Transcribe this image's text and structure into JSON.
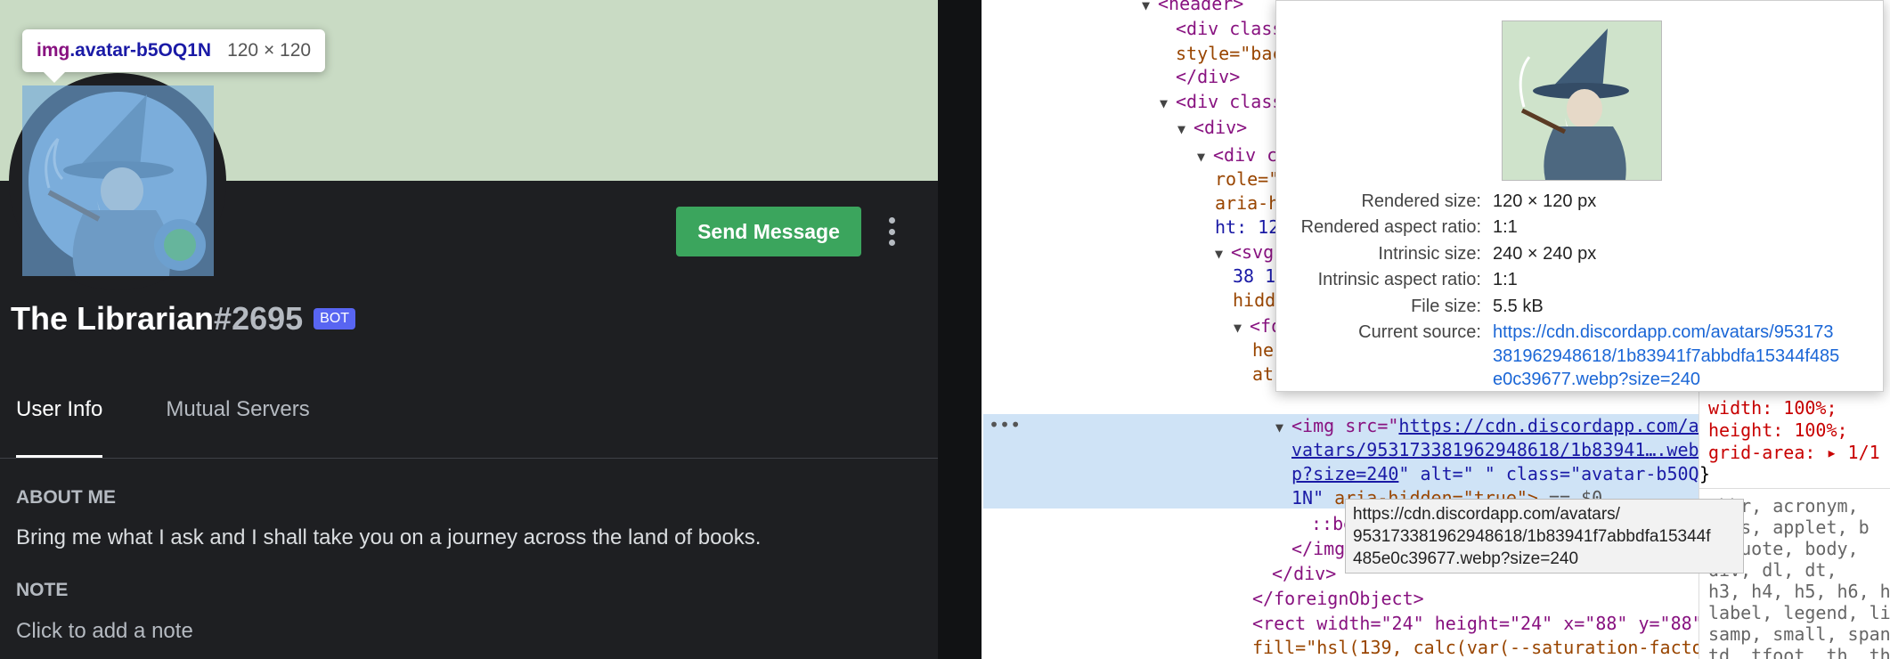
{
  "inspect_tooltip": {
    "tag": "img",
    "class_name": ".avatar-b5OQ1N",
    "size": "120 × 120"
  },
  "profile": {
    "send_message_label": "Send Message",
    "username": "The Librarian",
    "discriminator": "#2695",
    "bot_tag": "BOT",
    "tabs": [
      {
        "label": "User Info",
        "active": true
      },
      {
        "label": "Mutual Servers",
        "active": false
      }
    ],
    "about_heading": "ABOUT ME",
    "about_text": "Bring me what I ask and I shall take you on a journey across the land of books.",
    "note_heading": "NOTE",
    "note_placeholder": "Click to add a note",
    "colors": {
      "banner": "#c9dbc4",
      "button": "#3ba55d",
      "bot_tag": "#5865f2",
      "status": "#66b59c"
    }
  },
  "devtools": {
    "lines": {
      "header": "<header>",
      "div_class_1": "<div class",
      "style_ba": "style=\"bac",
      "div_close": "</div>",
      "div_class_2": "<div class",
      "div_open": "<div>",
      "div_c": "<div c",
      "role": "role=\"",
      "aria_h": "aria-h",
      "ht_12": "ht: 12",
      "svg": "<svg",
      "n38_1": "38 1",
      "hidd": "hidd",
      "fo": "<fo",
      "he": "he",
      "at": "at",
      "img_line_1_open": "<img src=\"",
      "img_url_1": "https://cdn.discordapp.com/a",
      "img_url_2": "vatars/953173381962948618/1b83941….web",
      "img_url_3": "p?size=240",
      "img_alt_class": "\" alt=\" \" class=\"avatar-b50Q",
      "img_class_end": "1N\"",
      "img_aria": " aria-hidden=\"true\"> ",
      "img_eq": "== $0",
      "before": "::be",
      "img_close": "</img>",
      "div_close_2": "</div>",
      "foreign_close": "</foreignObject>",
      "rect_line": "<rect width=\"24\" height=\"24\" x=\"88\" y=\"88\"",
      "fill_line": "fill=\"hsl(139, calc(var(--saturation-facto"
    },
    "styles": {
      "width": "width: 100%;",
      "height": "height: 100%;",
      "grid_area": "grid-area: ▸ 1/1",
      "brace": "}",
      "ua_1": "abbr, acronym,",
      "ua_2": "ress, applet, b",
      "ua_3": "ckquote, body,",
      "ua_4": "div, dl, dt,",
      "ua_5": "h3, h4, h5, h6, ht",
      "ua_6": "label, legend, li,",
      "ua_7": "samp, small, span,",
      "ua_8": "td, tfoot, th, the"
    },
    "image_popover": {
      "rendered_size_label": "Rendered size:",
      "rendered_size": "120 × 120 px",
      "rendered_ratio_label": "Rendered aspect ratio:",
      "rendered_ratio": "1:1",
      "intrinsic_size_label": "Intrinsic size:",
      "intrinsic_size": "240 × 240 px",
      "intrinsic_ratio_label": "Intrinsic aspect ratio:",
      "intrinsic_ratio": "1:1",
      "file_size_label": "File size:",
      "file_size": "5.5 kB",
      "current_source_label": "Current source:",
      "source_line_1": "https://cdn.discordapp.com/avatars/953173",
      "source_line_2": "381962948618/1b83941f7abbdfa15344f485",
      "source_line_3": "e0c39677.webp?size=240"
    },
    "url_tooltip": {
      "line_1": "https://cdn.discordapp.com/avatars/",
      "line_2": "953173381962948618/1b83941f7abbdfa15344f",
      "line_3": "485e0c39677.webp?size=240"
    }
  }
}
